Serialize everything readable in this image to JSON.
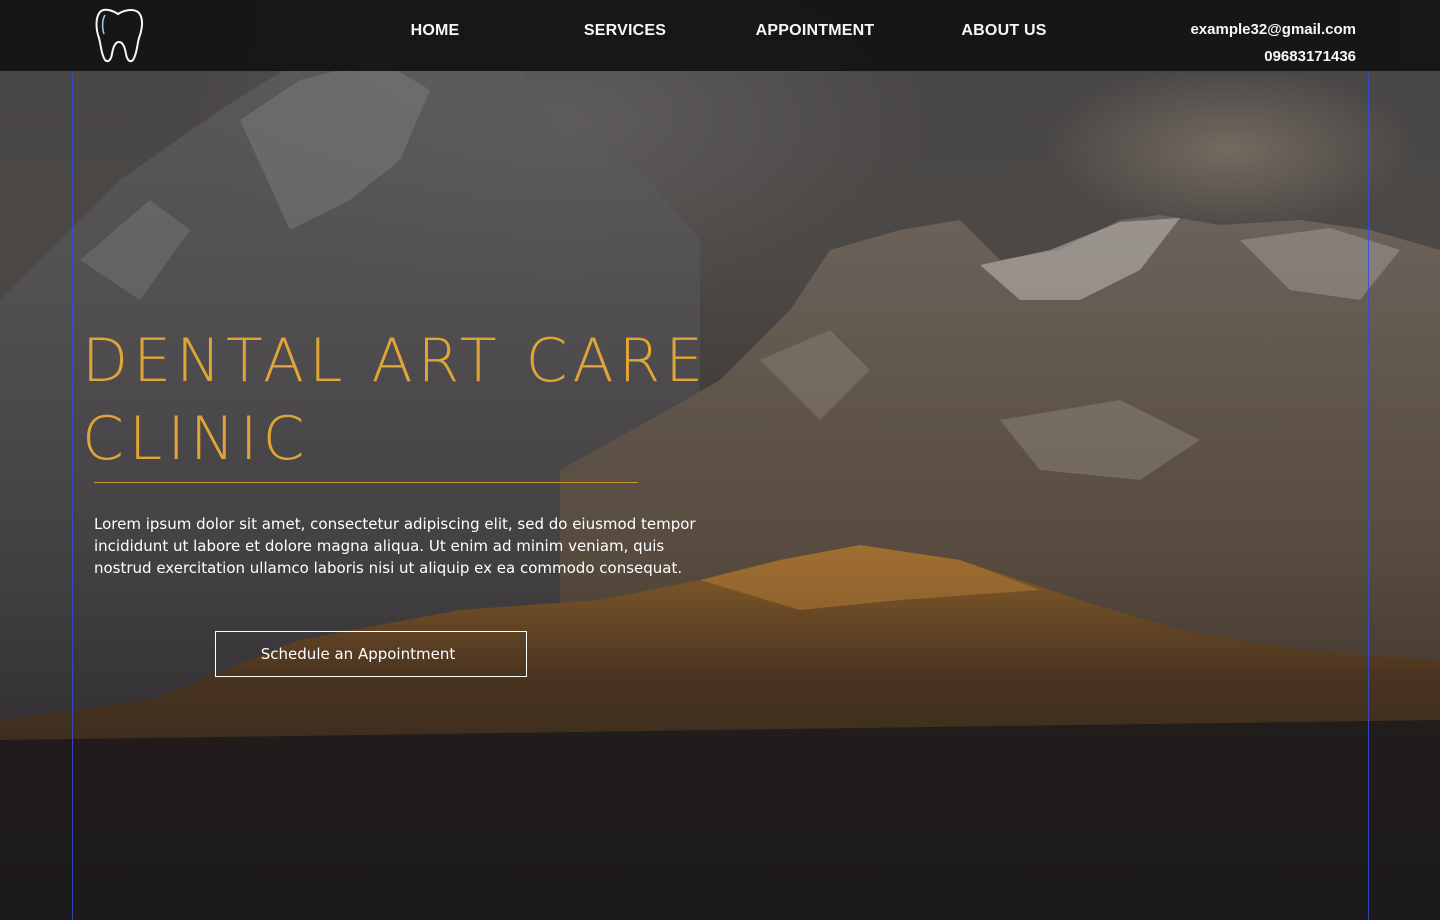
{
  "brand": {
    "logo_icon": "tooth-icon"
  },
  "nav": {
    "items": [
      {
        "label": "HOME"
      },
      {
        "label": "SERVICES"
      },
      {
        "label": "APPOINTMENT"
      },
      {
        "label": "ABOUT US"
      }
    ]
  },
  "contact": {
    "email": "example32@gmail.com",
    "phone": "09683171436"
  },
  "hero": {
    "title_line1": "DENTAL ART CARE",
    "title_line2": "CLINIC",
    "description": "Lorem ipsum dolor sit amet, consectetur adipiscing elit, sed do eiusmod tempor incididunt ut labore et dolore magna aliqua. Ut enim ad minim veniam, quis nostrud exercitation ullamco laboris nisi ut aliquip ex ea commodo consequat.",
    "cta_label": "Schedule an Appointment"
  },
  "colors": {
    "accent_gold": "#e0a437",
    "navbar_bg": "#151515",
    "guide_blue": "#2f4fd9"
  }
}
